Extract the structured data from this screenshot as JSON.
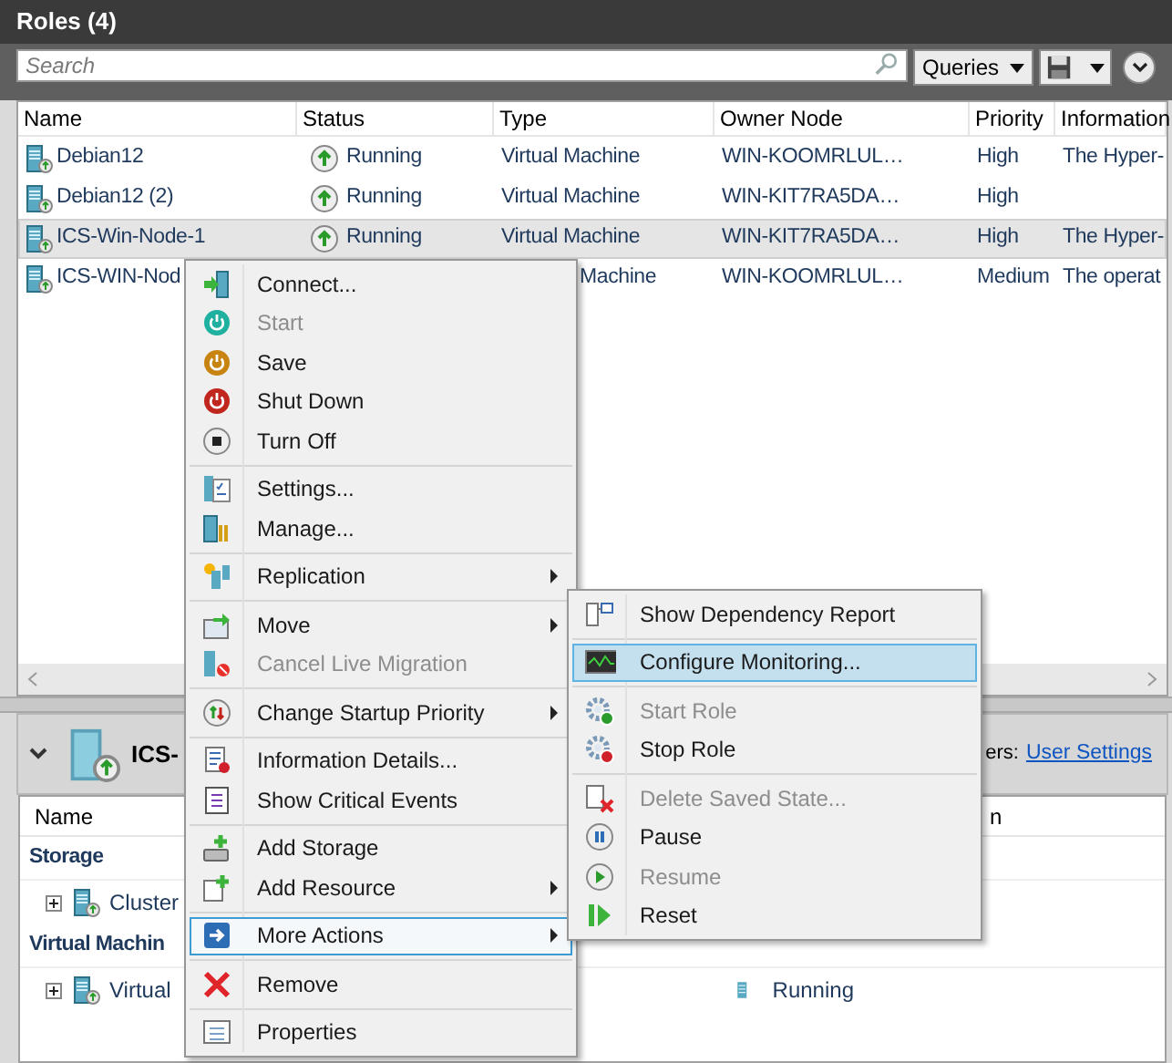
{
  "title": "Roles (4)",
  "toolbar": {
    "search": {
      "placeholder": "Search"
    },
    "queries_button": "Queries"
  },
  "table": {
    "columns": [
      "Name",
      "Status",
      "Type",
      "Owner Node",
      "Priority",
      "Information"
    ],
    "rows": [
      {
        "selected": false,
        "name": "Debian12",
        "status": "Running",
        "type": "Virtual Machine",
        "type_cut": false,
        "owner": "WIN-KOOMRLUL…",
        "priority": "High",
        "information": "The Hyper-"
      },
      {
        "selected": false,
        "name": "Debian12 (2)",
        "status": "Running",
        "type": "Virtual Machine",
        "type_cut": false,
        "owner": "WIN-KIT7RA5DA…",
        "priority": "High"
      },
      {
        "selected": true,
        "name": "ICS-Win-Node-1",
        "status": "Running",
        "type": "Virtual Machine",
        "type_cut": false,
        "owner": "WIN-KIT7RA5DA…",
        "priority": "High",
        "information": "The Hyper-"
      },
      {
        "selected": false,
        "name": "ICS-WIN-Nod",
        "type": "Machine",
        "type_cut": true,
        "owner": "WIN-KOOMRLUL…",
        "priority": "Medium",
        "information": "The operat"
      }
    ]
  },
  "details": {
    "title": "ICS-",
    "owners_label": "ers:",
    "link": "User Settings",
    "columns": [
      "Name",
      "n"
    ],
    "groups": [
      {
        "label": "Storage",
        "rows": [
          {
            "name": "Cluster",
            "expanded": false
          }
        ]
      },
      {
        "label": "Virtual Machin",
        "rows": [
          {
            "name": "Virtual",
            "status": "Running",
            "expanded": false
          }
        ]
      }
    ]
  },
  "context_menu": {
    "groups": [
      [
        {
          "label": "Connect...",
          "disabled": false,
          "submenu": false,
          "selected": false
        },
        {
          "label": "Start",
          "disabled": true,
          "submenu": false,
          "selected": false
        },
        {
          "label": "Save",
          "disabled": false,
          "submenu": false,
          "selected": false
        },
        {
          "label": "Shut Down",
          "disabled": false,
          "submenu": false,
          "selected": false
        },
        {
          "label": "Turn Off",
          "disabled": false,
          "submenu": false,
          "selected": false
        }
      ],
      [
        {
          "label": "Settings...",
          "disabled": false,
          "submenu": false,
          "selected": false
        },
        {
          "label": "Manage...",
          "disabled": false,
          "submenu": false,
          "selected": false
        }
      ],
      [
        {
          "label": "Replication",
          "disabled": false,
          "submenu": true,
          "selected": false
        }
      ],
      [
        {
          "label": "Move",
          "disabled": false,
          "submenu": true,
          "selected": false
        },
        {
          "label": "Cancel Live Migration",
          "disabled": true,
          "submenu": false,
          "selected": false
        }
      ],
      [
        {
          "label": "Change Startup Priority",
          "disabled": false,
          "submenu": true,
          "selected": false
        }
      ],
      [
        {
          "label": "Information Details...",
          "disabled": false,
          "submenu": false,
          "selected": false
        },
        {
          "label": "Show Critical Events",
          "disabled": false,
          "submenu": false,
          "selected": false
        }
      ],
      [
        {
          "label": "Add Storage",
          "disabled": false,
          "submenu": false,
          "selected": false
        },
        {
          "label": "Add Resource",
          "disabled": false,
          "submenu": true,
          "selected": false
        }
      ],
      [
        {
          "label": "More Actions",
          "disabled": false,
          "submenu": true,
          "selected": true
        }
      ],
      [
        {
          "label": "Remove",
          "disabled": false,
          "submenu": false,
          "selected": false
        }
      ],
      [
        {
          "label": "Properties",
          "disabled": false,
          "submenu": false,
          "selected": false
        }
      ]
    ]
  },
  "submenu": {
    "groups": [
      [
        {
          "label": "Show Dependency Report",
          "disabled": false,
          "submenu": false,
          "selected": false
        }
      ],
      [
        {
          "label": "Configure Monitoring...",
          "disabled": false,
          "submenu": false,
          "selected": true
        }
      ],
      [
        {
          "label": "Start Role",
          "disabled": true,
          "submenu": false,
          "selected": false
        },
        {
          "label": "Stop Role",
          "disabled": false,
          "submenu": false,
          "selected": false
        }
      ],
      [
        {
          "label": "Delete Saved State...",
          "disabled": true,
          "submenu": false,
          "selected": false
        },
        {
          "label": "Pause",
          "disabled": false,
          "submenu": false,
          "selected": false
        },
        {
          "label": "Resume",
          "disabled": true,
          "submenu": false,
          "selected": false
        },
        {
          "label": "Reset",
          "disabled": false,
          "submenu": false,
          "selected": false
        }
      ]
    ]
  }
}
